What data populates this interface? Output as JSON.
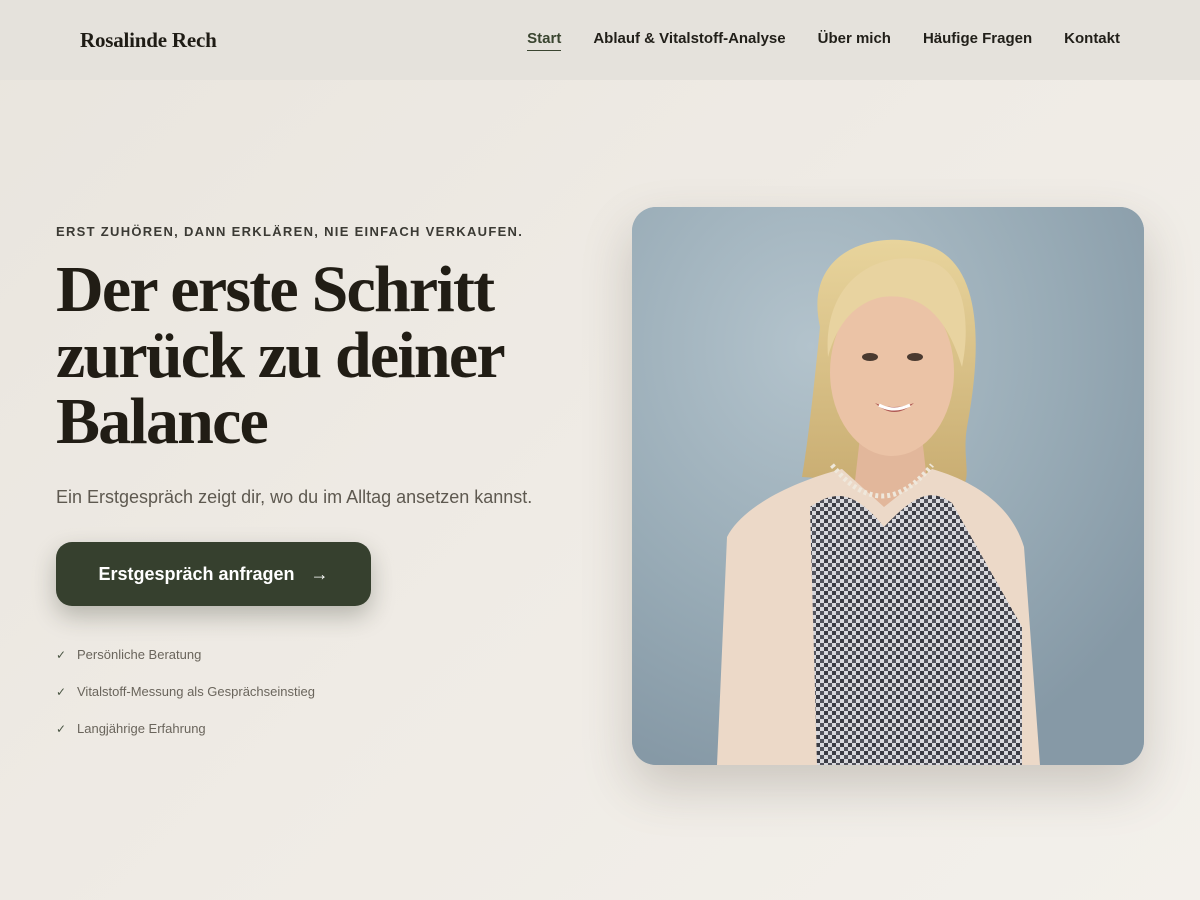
{
  "nav": {
    "brand": "Rosalinde Rech",
    "links": [
      {
        "label": "Start",
        "active": true
      },
      {
        "label": "Ablauf & Vitalstoff-Analyse",
        "active": false
      },
      {
        "label": "Über mich",
        "active": false
      },
      {
        "label": "Häufige Fragen",
        "active": false
      },
      {
        "label": "Kontakt",
        "active": false
      }
    ]
  },
  "hero": {
    "eyebrow": "ERST ZUHÖREN, DANN ERKLÄREN, NIE EINFACH VERKAUFEN.",
    "headline": "Der erste Schritt zurück zu deiner Balance",
    "subline": "Ein Erstgespräch zeigt dir, wo du im Alltag ansetzen kannst.",
    "cta_label": "Erstgespräch anfragen",
    "cta_icon": "arrow-right-icon",
    "check_icon": "check-icon",
    "checks": [
      "Persönliche Beratung",
      "Vitalstoff-Messung als Gesprächseinstieg",
      "Langjährige Erfahrung"
    ]
  },
  "colors": {
    "accent": "#36402e",
    "nav_bg": "#e5e2dc",
    "text_dark": "#211d15"
  }
}
